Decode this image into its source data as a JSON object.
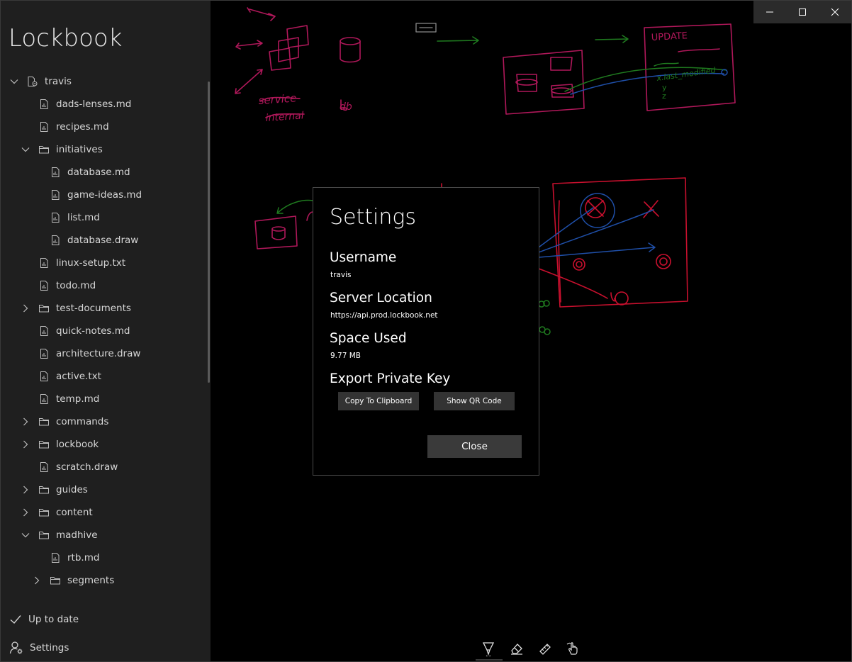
{
  "app": {
    "title": "Lockbook"
  },
  "tree": {
    "rows": [
      {
        "label": "travis",
        "kind": "root",
        "level": 0,
        "expanded": true
      },
      {
        "label": "dads-lenses.md",
        "kind": "file",
        "level": 1
      },
      {
        "label": "recipes.md",
        "kind": "file",
        "level": 1
      },
      {
        "label": "initiatives",
        "kind": "folder",
        "level": 1,
        "expanded": true
      },
      {
        "label": "database.md",
        "kind": "file",
        "level": 2
      },
      {
        "label": "game-ideas.md",
        "kind": "file",
        "level": 2
      },
      {
        "label": "list.md",
        "kind": "file",
        "level": 2
      },
      {
        "label": "database.draw",
        "kind": "file",
        "level": 2
      },
      {
        "label": "linux-setup.txt",
        "kind": "file",
        "level": 1
      },
      {
        "label": "todo.md",
        "kind": "file",
        "level": 1
      },
      {
        "label": "test-documents",
        "kind": "folder",
        "level": 1,
        "expanded": false
      },
      {
        "label": "quick-notes.md",
        "kind": "file",
        "level": 1
      },
      {
        "label": "architecture.draw",
        "kind": "file",
        "level": 1
      },
      {
        "label": "active.txt",
        "kind": "file",
        "level": 1
      },
      {
        "label": "temp.md",
        "kind": "file",
        "level": 1
      },
      {
        "label": "commands",
        "kind": "folder",
        "level": 1,
        "expanded": false
      },
      {
        "label": "lockbook",
        "kind": "folder",
        "level": 1,
        "expanded": false
      },
      {
        "label": "scratch.draw",
        "kind": "file",
        "level": 1
      },
      {
        "label": "guides",
        "kind": "folder",
        "level": 1,
        "expanded": false
      },
      {
        "label": "content",
        "kind": "folder",
        "level": 1,
        "expanded": false
      },
      {
        "label": "madhive",
        "kind": "folder",
        "level": 1,
        "expanded": true
      },
      {
        "label": "rtb.md",
        "kind": "file",
        "level": 2
      },
      {
        "label": "segments",
        "kind": "folder",
        "level": 2,
        "expanded": false
      }
    ]
  },
  "sidebar_footer": {
    "status_label": "Up to date",
    "settings_label": "Settings"
  },
  "canvas": {
    "sketch_text": {
      "service": "service",
      "internal": "internal",
      "db": "db",
      "update": "UPDATE",
      "last_modified": "x.last_modified",
      "y": "y",
      "z": "z"
    }
  },
  "toolbar": {
    "tools": [
      "pen-icon",
      "eraser-icon",
      "ruler-icon",
      "touch-draw-icon"
    ]
  },
  "settings_dialog": {
    "title": "Settings",
    "username_heading": "Username",
    "username_value": "travis",
    "server_heading": "Server Location",
    "server_value": "https://api.prod.lockbook.net",
    "space_heading": "Space Used",
    "space_value": "9.77 MB",
    "export_heading": "Export Private Key",
    "copy_button": "Copy To Clipboard",
    "qr_button": "Show QR Code",
    "close_button": "Close"
  },
  "colors": {
    "sidebar_bg": "#1f1f1f",
    "canvas_bg": "#000000",
    "ink_magenta": "#b0185a",
    "ink_red": "#c8102e",
    "ink_green": "#1f7a1f",
    "ink_blue": "#1f4fa8"
  }
}
